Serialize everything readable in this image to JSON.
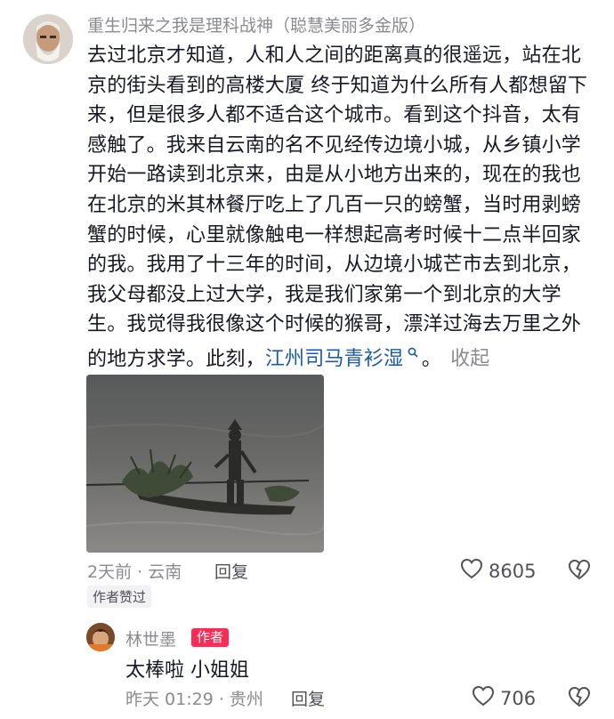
{
  "comment": {
    "username": "重生归来之我是理科战神（聪慧美丽多金版）",
    "text_before_mention": "去过北京才知道，人和人之间的距离真的很遥远，站在北京的街头看到的高楼大厦 终于知道为什么所有人都想留下来，但是很多人都不适合这个城市。看到这个抖音，太有感触了。我来自云南的名不见经传边境小城，从乡镇小学开始一路读到北京来，由是从小地方出来的，现在的我也在北京的米其林餐厅吃上了几百一只的螃蟹，当时用剥螃蟹的时候，心里就像触电一样想起高考时候十二点半回家的我。我用了十三年的时间，从边境小城芒市去到北京，我父母都没上过大学，我是我们家第一个到北京的大学生。我觉得我很像这个时候的猴哥，漂洋过海去万里之外的地方求学。此刻，",
    "mention": "江州司马青衫湿",
    "text_after_mention": "。",
    "collapse_label": "收起",
    "time_location": "2天前 · 云南",
    "reply_label": "回复",
    "like_count": "8605",
    "author_liked_label": "作者赞过"
  },
  "reply": {
    "username": "林世墨",
    "author_badge": "作者",
    "text": "太棒啦 小姐姐",
    "time_location": "昨天 01:29 · 贵州",
    "reply_label": "回复",
    "like_count": "706"
  },
  "colors": {
    "text": "#161823",
    "secondary": "#8a8b91",
    "mention": "#1a5aa8",
    "badge": "#fe2c55"
  },
  "icons": {
    "like": "heart-outline-icon",
    "dislike": "broken-heart-icon",
    "search": "search-icon"
  }
}
